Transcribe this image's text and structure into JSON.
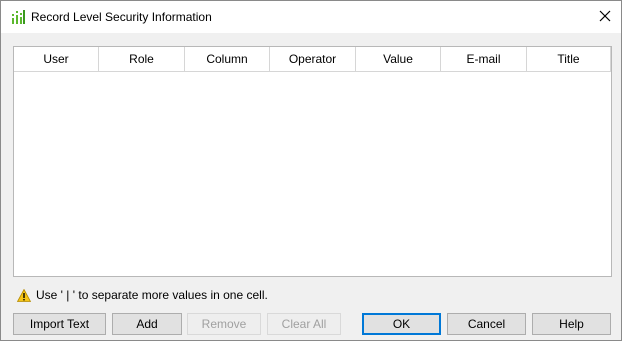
{
  "window": {
    "title": "Record Level Security Information"
  },
  "table": {
    "columns": [
      "User",
      "Role",
      "Column",
      "Operator",
      "Value",
      "E-mail",
      "Title"
    ],
    "rows": []
  },
  "hint": {
    "text": "Use ' | ' to separate more values in one cell."
  },
  "buttons": {
    "import_text": "Import Text",
    "add": "Add",
    "remove": "Remove",
    "clear_all": "Clear All",
    "ok": "OK",
    "cancel": "Cancel",
    "help": "Help"
  },
  "colors": {
    "accent": "#0078d7",
    "icon_green": "#5cb82e",
    "warning_yellow": "#f5c518"
  }
}
